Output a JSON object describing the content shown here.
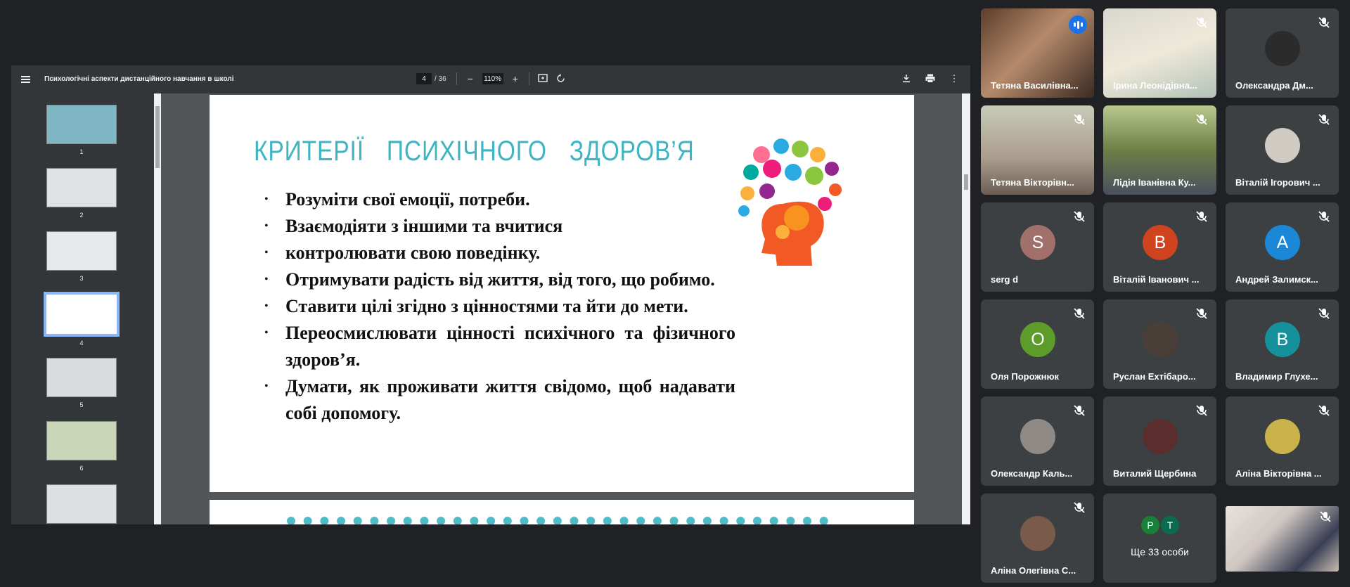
{
  "pdf": {
    "title": "Психологічні аспекти дистанційного навчання в школі",
    "current_page": "4",
    "total_pages": "/ 36",
    "zoom": "110%",
    "thumbnails": [
      "1",
      "2",
      "3",
      "4",
      "5",
      "6"
    ],
    "active_thumbnail": "4"
  },
  "slide": {
    "title": "КРИТЕРІЇ ПСИХІЧНОГО ЗДОРОВ’Я",
    "bullets": [
      "Розуміти свої емоції, потреби.",
      "Взаємодіяти з іншими та вчитися",
      " контролювати свою поведінку.",
      "Отримувати радість від життя, від того, що робимо.",
      "Ставити цілі згідно з цінностями та йти до мети.",
      "Переосмислювати цінності психічного та фізичного здоров’я.",
      "Думати, як проживати життя свідомо, щоб надавати собі допомогу."
    ]
  },
  "participants": [
    {
      "name": "Тетяна Василівна...",
      "type": "video",
      "speaking": true
    },
    {
      "name": "Ірина Леонідівна...",
      "type": "video",
      "muted": true
    },
    {
      "name": "Олександра Дм...",
      "type": "photo",
      "muted": true
    },
    {
      "name": "Тетяна Вікторівн...",
      "type": "video",
      "muted": true
    },
    {
      "name": "Лідія Іванівна Ку...",
      "type": "video",
      "muted": true
    },
    {
      "name": "Віталій Ігорович ...",
      "type": "photo",
      "muted": true
    },
    {
      "name": "serg d",
      "type": "letter",
      "letter": "S",
      "color": "#a1706a",
      "muted": true
    },
    {
      "name": "Віталій Іванович ...",
      "type": "letter",
      "letter": "В",
      "color": "#d0431f",
      "muted": true
    },
    {
      "name": "Андрей Залимск...",
      "type": "letter",
      "letter": "A",
      "color": "#1a88d6",
      "muted": true
    },
    {
      "name": "Оля Порожнюк",
      "type": "letter",
      "letter": "O",
      "color": "#5d9b2a",
      "muted": true
    },
    {
      "name": "Руслан Ехтібаро...",
      "type": "photo",
      "muted": true
    },
    {
      "name": "Владимир Глухе...",
      "type": "letter",
      "letter": "B",
      "color": "#14919b",
      "muted": true
    },
    {
      "name": "Олександр Каль...",
      "type": "photo",
      "muted": true
    },
    {
      "name": "Виталий Щербина",
      "type": "photo",
      "muted": true
    },
    {
      "name": "Аліна Вікторівна ...",
      "type": "photo",
      "muted": true
    },
    {
      "name": "Аліна Олегівна С...",
      "type": "photo",
      "muted": true
    },
    {
      "name": "Ще 33 особи",
      "type": "more",
      "letters": [
        "P",
        "T"
      ],
      "colors": [
        "#188038",
        "#0b6b4f"
      ]
    },
    {
      "name": "",
      "type": "video",
      "muted": true
    }
  ],
  "colors": {
    "accent_title": "#3eb5c2",
    "speaking_border": "#8ab4f8",
    "tile_bg": "#3c4043"
  }
}
